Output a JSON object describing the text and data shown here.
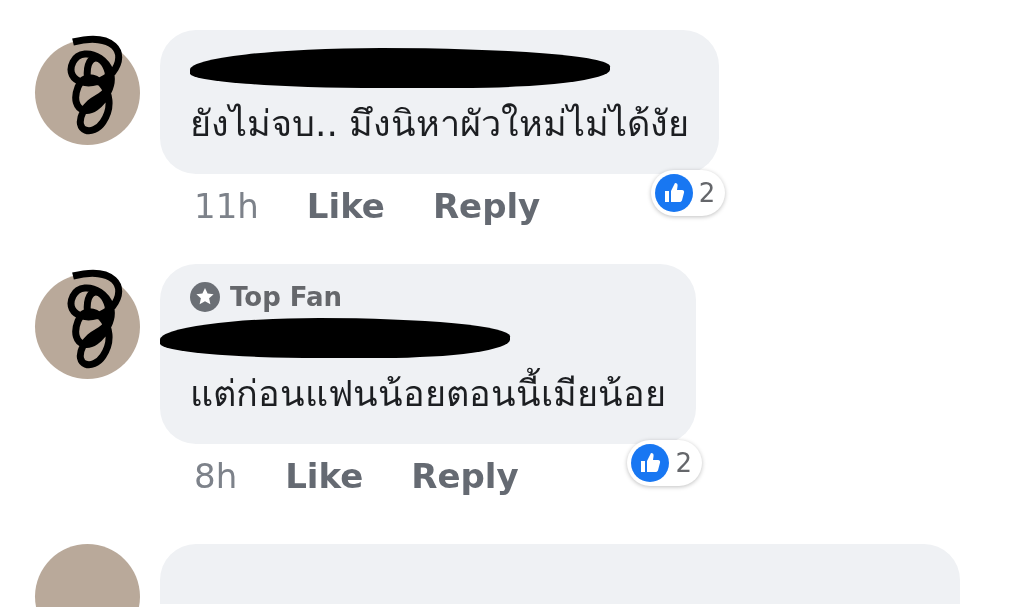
{
  "comments": [
    {
      "kind": "full",
      "text": "ยังไม่จบ.. มึงนิหาผัวใหม่ไม่ได้งัย",
      "time": "11h",
      "actions": [
        "Like",
        "Reply"
      ],
      "reaction_count": "2"
    },
    {
      "kind": "full",
      "badge_label": "Top Fan",
      "text": "แต่ก่อนแฟนน้อยตอนนี้เมียน้อย",
      "time": "8h",
      "actions": [
        "Like",
        "Reply"
      ],
      "reaction_count": "2"
    },
    {
      "kind": "cut_off"
    }
  ]
}
